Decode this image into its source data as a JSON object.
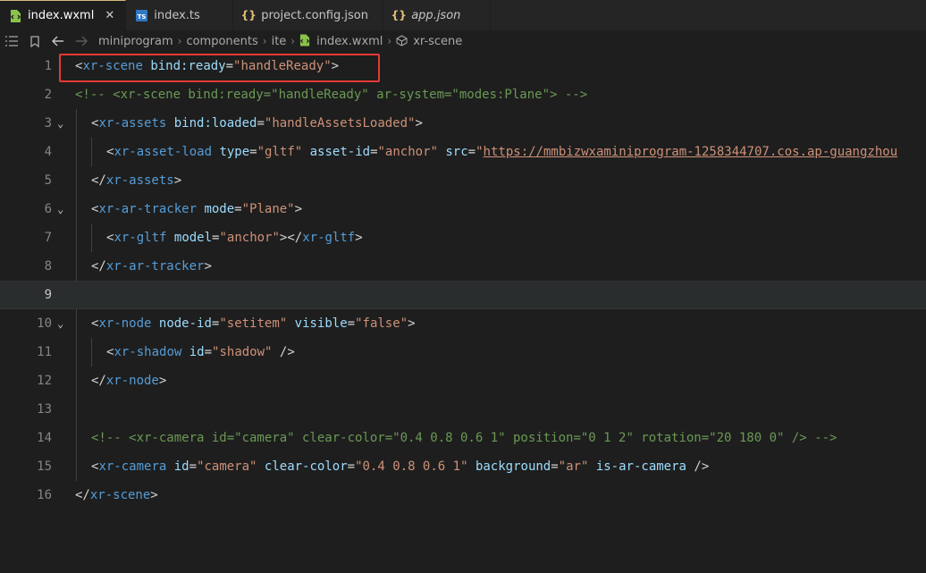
{
  "tabs": [
    {
      "label": "index.wxml",
      "icon": "wxml-file-icon",
      "active": true,
      "italic": false
    },
    {
      "label": "index.ts",
      "icon": "typescript-file-icon",
      "active": false,
      "italic": false
    },
    {
      "label": "project.config.json",
      "icon": "json-file-icon",
      "active": false,
      "italic": false
    },
    {
      "label": "app.json",
      "icon": "json-file-icon",
      "active": false,
      "italic": true
    }
  ],
  "tab_close_glyph": "✕",
  "breadcrumb": [
    "miniprogram",
    "components",
    "ite",
    "index.wxml",
    "xr-scene"
  ],
  "colors": {
    "background": "#1e1e1e",
    "tag": "#569cd6",
    "attribute": "#9cdcfe",
    "string": "#ce9178",
    "comment": "#6a9955",
    "highlight_box": "#e53935"
  },
  "editor": {
    "current_line": 9,
    "lines": [
      {
        "n": "1"
      },
      {
        "n": "2"
      },
      {
        "n": "3"
      },
      {
        "n": "4"
      },
      {
        "n": "5"
      },
      {
        "n": "6"
      },
      {
        "n": "7"
      },
      {
        "n": "8"
      },
      {
        "n": "9"
      },
      {
        "n": "10"
      },
      {
        "n": "11"
      },
      {
        "n": "12"
      },
      {
        "n": "13"
      },
      {
        "n": "14"
      },
      {
        "n": "15"
      },
      {
        "n": "16"
      }
    ],
    "code": {
      "l1": {
        "open": "<",
        "tag": "xr-scene",
        "attr": "bind:ready",
        "eq": "=",
        "val": "\"handleReady\"",
        "close": ">"
      },
      "l2": "<!-- <xr-scene bind:ready=\"handleReady\" ar-system=\"modes:Plane\"> -->",
      "l3": {
        "open": "<",
        "tag": "xr-assets",
        "attr": "bind:loaded",
        "eq": "=",
        "val": "\"handleAssetsLoaded\"",
        "close": ">"
      },
      "l4": {
        "open": "<",
        "tag": "xr-asset-load",
        "a1": "type",
        "v1": "\"gltf\"",
        "a2": "asset-id",
        "v2": "\"anchor\"",
        "a3": "src",
        "q": "\"",
        "url": "https://mmbizwxaminiprogram-1258344707.cos.ap-guangzhou"
      },
      "l5": {
        "open": "</",
        "tag": "xr-assets",
        "close": ">"
      },
      "l6": {
        "open": "<",
        "tag": "xr-ar-tracker",
        "attr": "mode",
        "eq": "=",
        "val": "\"Plane\"",
        "close": ">"
      },
      "l7": {
        "open": "<",
        "tag": "xr-gltf",
        "attr": "model",
        "eq": "=",
        "val": "\"anchor\"",
        "mid": "></",
        "tag2": "xr-gltf",
        "close": ">"
      },
      "l8": {
        "open": "</",
        "tag": "xr-ar-tracker",
        "close": ">"
      },
      "l10": {
        "open": "<",
        "tag": "xr-node",
        "a1": "node-id",
        "v1": "\"setitem\"",
        "a2": "visible",
        "v2": "\"false\"",
        "close": ">"
      },
      "l11": {
        "open": "<",
        "tag": "xr-shadow",
        "attr": "id",
        "eq": "=",
        "val": "\"shadow\"",
        "close": " />"
      },
      "l12": {
        "open": "</",
        "tag": "xr-node",
        "close": ">"
      },
      "l14": "<!-- <xr-camera id=\"camera\" clear-color=\"0.4 0.8 0.6 1\" position=\"0 1 2\" rotation=\"20 180 0\" /> -->",
      "l15": {
        "open": "<",
        "tag": "xr-camera",
        "a1": "id",
        "v1": "\"camera\"",
        "a2": "clear-color",
        "v2": "\"0.4 0.8 0.6 1\"",
        "a3": "background",
        "v3": "\"ar\"",
        "a4": "is-ar-camera",
        "close": " />"
      },
      "l16": {
        "open": "</",
        "tag": "xr-scene",
        "close": ">"
      }
    }
  }
}
